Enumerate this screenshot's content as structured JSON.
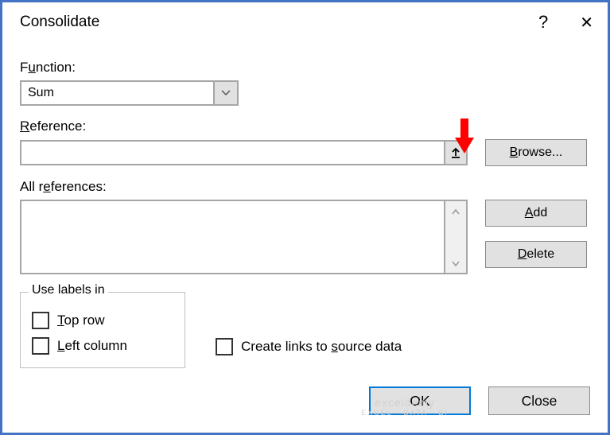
{
  "titlebar": {
    "title": "Consolidate",
    "help": "?",
    "close": "✕"
  },
  "function": {
    "label_pre": "F",
    "label_u": "u",
    "label_post": "nction:",
    "value": "Sum"
  },
  "reference": {
    "label_u": "R",
    "label_post": "eference:",
    "value": ""
  },
  "all_refs": {
    "label_pre": "All r",
    "label_u": "e",
    "label_post": "ferences:"
  },
  "buttons": {
    "browse_u": "B",
    "browse_post": "rowse...",
    "add_u": "A",
    "add_post": "dd",
    "delete_u": "D",
    "delete_post": "elete",
    "ok": "OK",
    "close": "Close"
  },
  "group": {
    "title": "Use labels in",
    "top_u": "T",
    "top_post": "op row",
    "left_u": "L",
    "left_post": "eft column",
    "links_pre": "Create links to ",
    "links_u": "s",
    "links_post": "ource data"
  },
  "watermark": {
    "main": "exceldemy",
    "sub": "EXCEL · DATA · BI"
  }
}
